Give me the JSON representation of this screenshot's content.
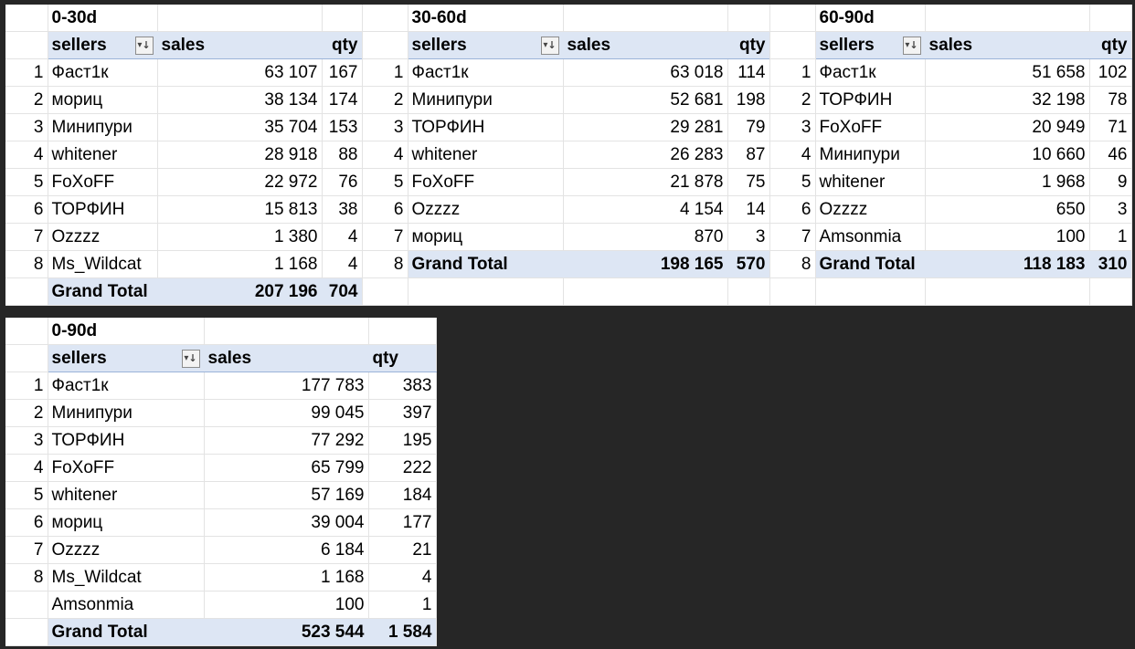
{
  "colors": {
    "background": "#262626",
    "header_fill": "#dde6f4",
    "header_border": "#9bb3d9",
    "grid": "#e3e3e3"
  },
  "icons": {
    "filter_sort": "filter-sort-icon"
  },
  "pivots": [
    {
      "id": "p0-30",
      "title": "0-30d",
      "headers": {
        "sellers": "sellers",
        "sales": "sales",
        "qty": "qty"
      },
      "rows": [
        {
          "n": "1",
          "seller": "Фаст1к",
          "sales": "63 107",
          "qty": "167"
        },
        {
          "n": "2",
          "seller": "мориц",
          "sales": "38 134",
          "qty": "174"
        },
        {
          "n": "3",
          "seller": "Минипури",
          "sales": "35 704",
          "qty": "153"
        },
        {
          "n": "4",
          "seller": "whitener",
          "sales": "28 918",
          "qty": "88"
        },
        {
          "n": "5",
          "seller": "FoXoFF",
          "sales": "22 972",
          "qty": "76"
        },
        {
          "n": "6",
          "seller": "ТОРФИН",
          "sales": "15 813",
          "qty": "38"
        },
        {
          "n": "7",
          "seller": "Ozzzz",
          "sales": "1 380",
          "qty": "4"
        },
        {
          "n": "8",
          "seller": "Ms_Wildcat",
          "sales": "1 168",
          "qty": "4"
        }
      ],
      "total": {
        "n": "",
        "label": "Grand Total",
        "sales": "207 196",
        "qty": "704"
      }
    },
    {
      "id": "p30-60",
      "title": "30-60d",
      "headers": {
        "sellers": "sellers",
        "sales": "sales",
        "qty": "qty"
      },
      "rows": [
        {
          "n": "1",
          "seller": "Фаст1к",
          "sales": "63 018",
          "qty": "114"
        },
        {
          "n": "2",
          "seller": "Минипури",
          "sales": "52 681",
          "qty": "198"
        },
        {
          "n": "3",
          "seller": "ТОРФИН",
          "sales": "29 281",
          "qty": "79"
        },
        {
          "n": "4",
          "seller": "whitener",
          "sales": "26 283",
          "qty": "87"
        },
        {
          "n": "5",
          "seller": "FoXoFF",
          "sales": "21 878",
          "qty": "75"
        },
        {
          "n": "6",
          "seller": "Ozzzz",
          "sales": "4 154",
          "qty": "14"
        },
        {
          "n": "7",
          "seller": "мориц",
          "sales": "870",
          "qty": "3"
        }
      ],
      "total": {
        "n": "8",
        "label": "Grand Total",
        "sales": "198 165",
        "qty": "570"
      }
    },
    {
      "id": "p60-90",
      "title": "60-90d",
      "headers": {
        "sellers": "sellers",
        "sales": "sales",
        "qty": "qty"
      },
      "rows": [
        {
          "n": "1",
          "seller": "Фаст1к",
          "sales": "51 658",
          "qty": "102"
        },
        {
          "n": "2",
          "seller": "ТОРФИН",
          "sales": "32 198",
          "qty": "78"
        },
        {
          "n": "3",
          "seller": "FoXoFF",
          "sales": "20 949",
          "qty": "71"
        },
        {
          "n": "4",
          "seller": "Минипури",
          "sales": "10 660",
          "qty": "46"
        },
        {
          "n": "5",
          "seller": "whitener",
          "sales": "1 968",
          "qty": "9"
        },
        {
          "n": "6",
          "seller": "Ozzzz",
          "sales": "650",
          "qty": "3"
        },
        {
          "n": "7",
          "seller": "Amsonmia",
          "sales": "100",
          "qty": "1"
        }
      ],
      "total": {
        "n": "8",
        "label": "Grand Total",
        "sales": "118 183",
        "qty": "310"
      }
    },
    {
      "id": "p0-90",
      "title": "0-90d",
      "headers": {
        "sellers": "sellers",
        "sales": "sales",
        "qty": "qty"
      },
      "rows": [
        {
          "n": "1",
          "seller": "Фаст1к",
          "sales": "177 783",
          "qty": "383"
        },
        {
          "n": "2",
          "seller": "Минипури",
          "sales": "99 045",
          "qty": "397"
        },
        {
          "n": "3",
          "seller": "ТОРФИН",
          "sales": "77 292",
          "qty": "195"
        },
        {
          "n": "4",
          "seller": "FoXoFF",
          "sales": "65 799",
          "qty": "222"
        },
        {
          "n": "5",
          "seller": "whitener",
          "sales": "57 169",
          "qty": "184"
        },
        {
          "n": "6",
          "seller": "мориц",
          "sales": "39 004",
          "qty": "177"
        },
        {
          "n": "7",
          "seller": "Ozzzz",
          "sales": "6 184",
          "qty": "21"
        },
        {
          "n": "8",
          "seller": "Ms_Wildcat",
          "sales": "1 168",
          "qty": "4"
        },
        {
          "n": "",
          "seller": "Amsonmia",
          "sales": "100",
          "qty": "1"
        }
      ],
      "total": {
        "n": "",
        "label": "Grand Total",
        "sales": "523 544",
        "qty": "1 584"
      }
    }
  ]
}
